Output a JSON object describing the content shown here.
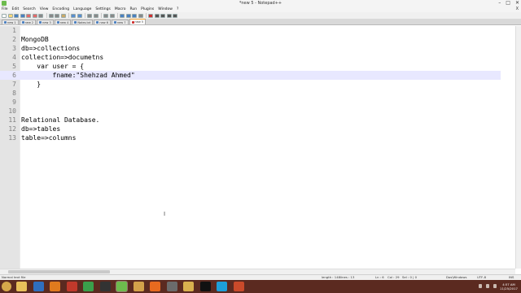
{
  "window": {
    "title": "*new 5 - Notepad++",
    "minimize": "–",
    "maximize": "□",
    "close": "✕"
  },
  "menu": [
    "File",
    "Edit",
    "Search",
    "View",
    "Encoding",
    "Language",
    "Settings",
    "Macro",
    "Run",
    "Plugins",
    "Window",
    "?"
  ],
  "menu_close": "X",
  "tabs": [
    {
      "label": "new 1"
    },
    {
      "label": "new 2"
    },
    {
      "label": "new 3"
    },
    {
      "label": "new 4"
    },
    {
      "label": "Notes.txt"
    },
    {
      "label": "new 6"
    },
    {
      "label": "new 7"
    },
    {
      "label": "new 5",
      "active": true
    }
  ],
  "editor": {
    "current_line": 6,
    "lines": [
      {
        "n": "1",
        "text": ""
      },
      {
        "n": "2",
        "text": "MongoDB"
      },
      {
        "n": "3",
        "text": "db=>collections"
      },
      {
        "n": "4",
        "text": "collection=>documetns"
      },
      {
        "n": "5",
        "text": "    var user = {"
      },
      {
        "n": "6",
        "text": "        fname:\"Shehzad Ahmed\""
      },
      {
        "n": "7",
        "text": "    }"
      },
      {
        "n": "8",
        "text": ""
      },
      {
        "n": "9",
        "text": ""
      },
      {
        "n": "10",
        "text": ""
      },
      {
        "n": "11",
        "text": "Relational Database."
      },
      {
        "n": "12",
        "text": "db=>tables"
      },
      {
        "n": "13",
        "text": "table=>columns"
      }
    ]
  },
  "cursor_glyph": "I",
  "status": {
    "file_type": "Normal text file",
    "length": "length : 148",
    "lines": "lines : 13",
    "position": "Ln : 6",
    "col": "Col : 29",
    "sel": "Sel : 0 | 0",
    "eol": "Dos\\Windows",
    "encoding": "UTF-8",
    "mode": "INS"
  },
  "taskbar": {
    "apps": [
      {
        "name": "windows-explorer-icon",
        "color": "#e8c05a"
      },
      {
        "name": "media-player-icon",
        "color": "#2f6fbf"
      },
      {
        "name": "xampp-icon",
        "color": "#e07a1e"
      },
      {
        "name": "filezilla-icon",
        "color": "#c0392b"
      },
      {
        "name": "chrome-icon",
        "color": "#3a9f4b"
      },
      {
        "name": "terminal-icon",
        "color": "#333333"
      },
      {
        "name": "notepadpp-icon",
        "color": "#6dbb4d"
      },
      {
        "name": "paint-icon",
        "color": "#d3a14a"
      },
      {
        "name": "firefox-icon",
        "color": "#e86a1f"
      },
      {
        "name": "generic-app-icon",
        "color": "#6b6b6b"
      },
      {
        "name": "folder-icon",
        "color": "#d8b04e"
      },
      {
        "name": "cmd-icon",
        "color": "#111111"
      },
      {
        "name": "skype-icon",
        "color": "#1d9fd8"
      },
      {
        "name": "office-icon",
        "color": "#c94a2a"
      }
    ],
    "clock_time": "4:57 AM",
    "clock_date": "11/25/2017"
  }
}
